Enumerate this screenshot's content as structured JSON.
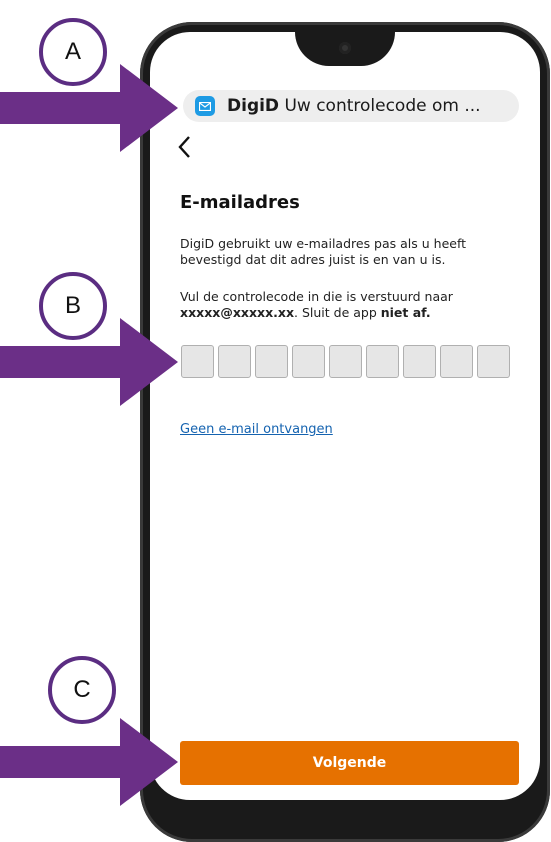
{
  "notification": {
    "app": "DigiD",
    "message": "Uw controlecode om ..."
  },
  "page": {
    "title": "E-mailadres",
    "intro": "DigiD gebruikt uw e-mailadres pas als u heeft bevestigd dat dit adres juist is en van u is.",
    "instruction_prefix": "Vul de controlecode in die is verstuurd naar ",
    "email": "xxxxx@xxxxx.xx",
    "instruction_middle": ". Sluit de app ",
    "instruction_bold": "niet af.",
    "code_length": 9,
    "link": "Geen e-mail ontvangen",
    "button": "Volgende"
  },
  "annotations": {
    "a": "A",
    "b": "B",
    "c": "C"
  },
  "colors": {
    "accent": "#e67100",
    "marker": "#5b2d82",
    "link": "#1563b0"
  }
}
